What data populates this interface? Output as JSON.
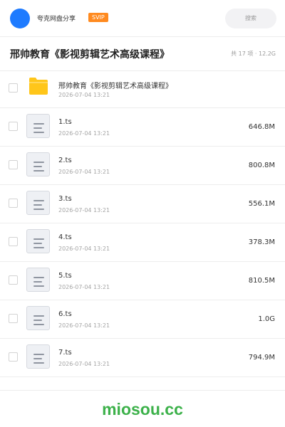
{
  "header": {
    "share_name": "夸克网盘分享",
    "badge": "SVIP",
    "search_placeholder": "搜索"
  },
  "title_row": {
    "title": "邢帅教育《影视剪辑艺术高级课程》",
    "summary": "共 17 项 · 12.2G"
  },
  "items": [
    {
      "type": "folder",
      "name": "邢帅教育《影视剪辑艺术高级课程》",
      "time": "2026-07-04 13:21",
      "size": ""
    },
    {
      "type": "file",
      "name": "1.ts",
      "time": "2026-07-04 13:21",
      "size": "646.8M"
    },
    {
      "type": "file",
      "name": "2.ts",
      "time": "2026-07-04 13:21",
      "size": "800.8M"
    },
    {
      "type": "file",
      "name": "3.ts",
      "time": "2026-07-04 13:21",
      "size": "556.1M"
    },
    {
      "type": "file",
      "name": "4.ts",
      "time": "2026-07-04 13:21",
      "size": "378.3M"
    },
    {
      "type": "file",
      "name": "5.ts",
      "time": "2026-07-04 13:21",
      "size": "810.5M"
    },
    {
      "type": "file",
      "name": "6.ts",
      "time": "2026-07-04 13:21",
      "size": "1.0G"
    },
    {
      "type": "file",
      "name": "7.ts",
      "time": "2026-07-04 13:21",
      "size": "794.9M"
    }
  ],
  "footer": {
    "watermark": "miosou.cc"
  },
  "colors": {
    "avatar": "#1e7bff",
    "svip": "#ff8a1f",
    "folder": "#ffc61a",
    "watermark": "#3cb14a"
  }
}
